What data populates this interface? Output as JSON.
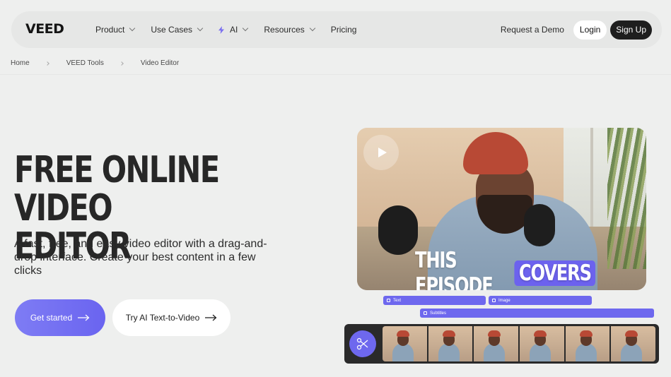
{
  "nav": {
    "logo": "VEED",
    "items": [
      {
        "label": "Product",
        "has_chevron": true
      },
      {
        "label": "Use Cases",
        "has_chevron": true
      },
      {
        "label": "AI",
        "has_chevron": true,
        "icon": "bolt-icon"
      },
      {
        "label": "Resources",
        "has_chevron": true
      },
      {
        "label": "Pricing",
        "has_chevron": false
      }
    ],
    "demo": "Request a Demo",
    "login": "Login",
    "signup": "Sign Up"
  },
  "breadcrumb": [
    "Home",
    "VEED Tools",
    "Video Editor"
  ],
  "hero": {
    "title_line1": "Free Online Video",
    "title_line2": "Editor",
    "subtitle": "A fast, free, and easy video editor with a drag-and-drop interface. Create your best content in a few clicks",
    "cta_primary": "Get started",
    "cta_secondary": "Try AI Text-to-Video"
  },
  "preview": {
    "caption_plain": "THIS EPISODE",
    "caption_highlight": "COVERS",
    "tracks": [
      {
        "label": "Text"
      },
      {
        "label": "Image"
      },
      {
        "label": "Subtitles"
      }
    ],
    "filmstrip_frames": 6
  },
  "colors": {
    "accent": "#6e68ee",
    "background": "#eeefee",
    "dark": "#1e1e1e"
  }
}
